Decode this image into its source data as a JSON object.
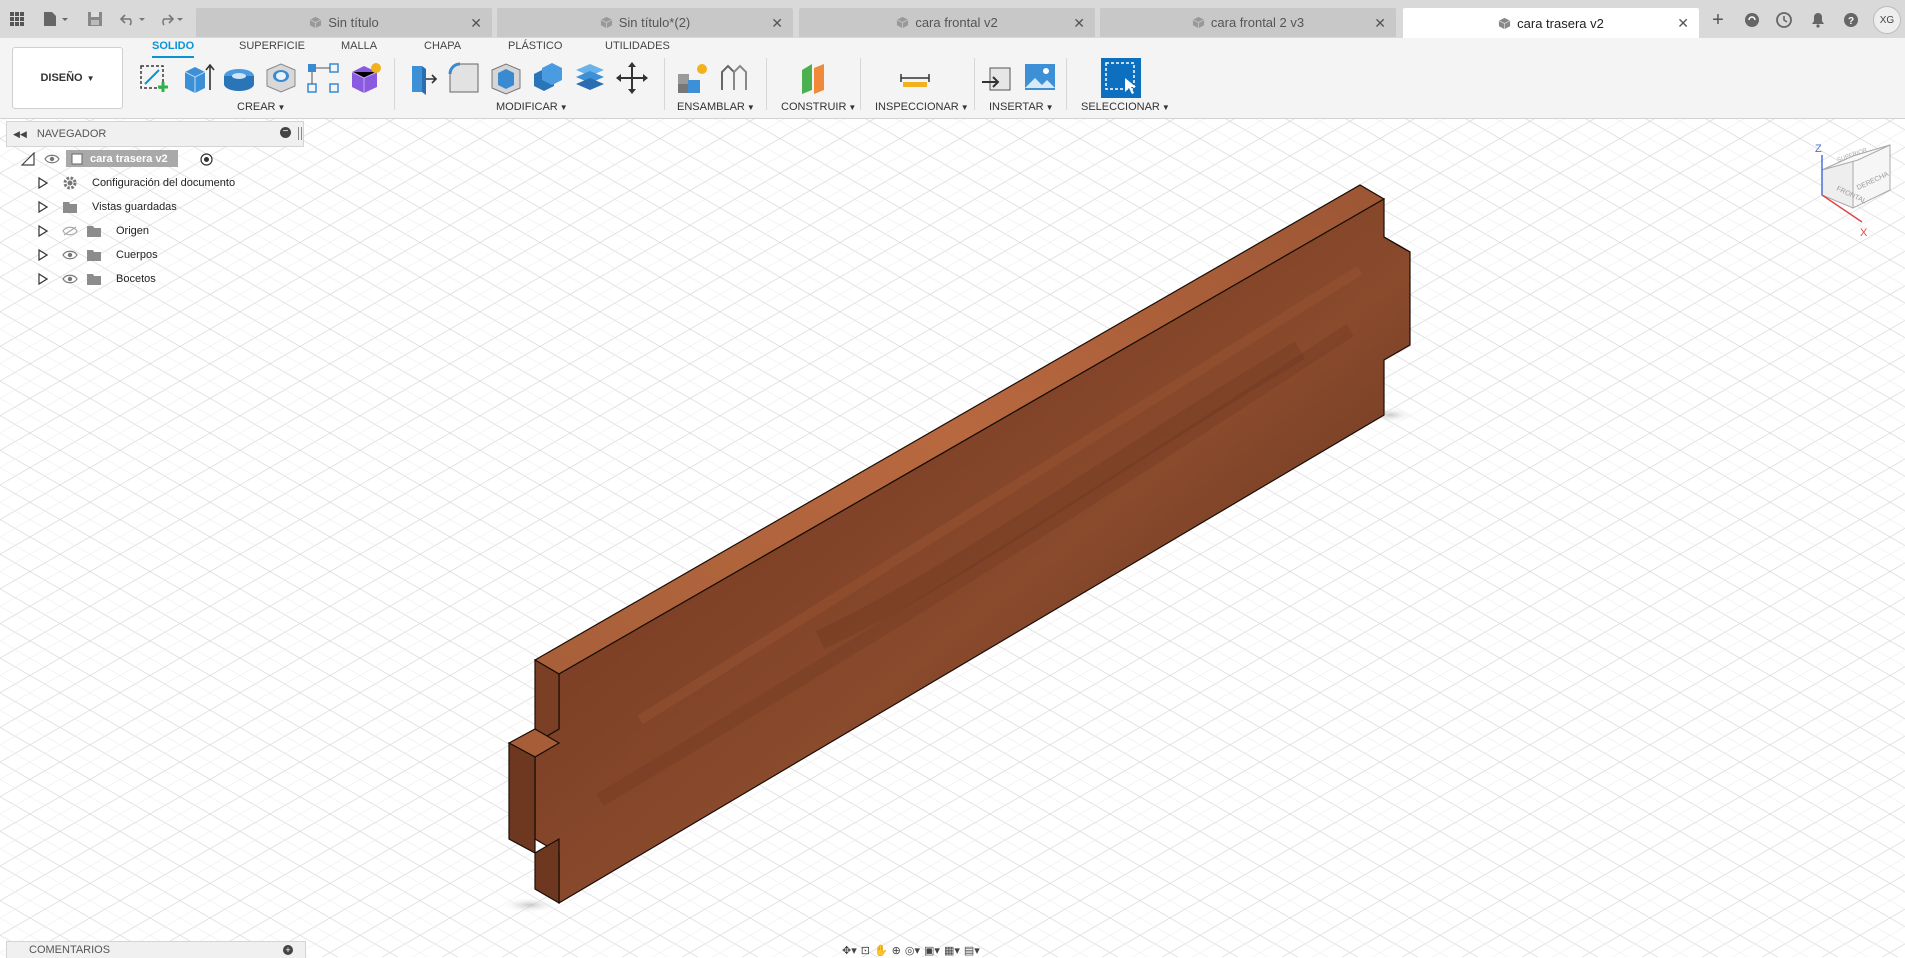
{
  "app": {
    "quick_access": [
      "grid-apps-icon",
      "file-icon",
      "save-icon",
      "undo-icon",
      "redo-icon"
    ],
    "user_initials": "XG"
  },
  "tabs": [
    {
      "label": "Sin título",
      "active": false
    },
    {
      "label": "Sin título*(2)",
      "active": false
    },
    {
      "label": "cara frontal v2",
      "active": false
    },
    {
      "label": "cara frontal 2 v3",
      "active": false
    },
    {
      "label": "cara trasera v2",
      "active": true
    }
  ],
  "ribbon": {
    "workspace": "DISEÑO",
    "tabs": [
      "SOLIDO",
      "SUPERFICIE",
      "MALLA",
      "CHAPA",
      "PLÁSTICO",
      "UTILIDADES"
    ],
    "active_tab": "SOLIDO",
    "groups": {
      "crear": "CREAR",
      "modificar": "MODIFICAR",
      "ensamblar": "ENSAMBLAR",
      "construir": "CONSTRUIR",
      "inspeccionar": "INSPECCIONAR",
      "insertar": "INSERTAR",
      "seleccionar": "SELECCIONAR"
    }
  },
  "navigator": {
    "title": "NAVEGADOR",
    "root": "cara trasera v2",
    "items": [
      {
        "label": "Configuración del documento",
        "icon": "gear-icon"
      },
      {
        "label": "Vistas guardadas",
        "icon": "folder-icon"
      },
      {
        "label": "Origen",
        "icon": "folder-icon",
        "visible": false
      },
      {
        "label": "Cuerpos",
        "icon": "folder-icon",
        "visible": true
      },
      {
        "label": "Bocetos",
        "icon": "folder-icon",
        "visible": true
      }
    ]
  },
  "comments": {
    "title": "COMENTARIOS"
  },
  "viewcube": {
    "faces": [
      "SUPERIOR",
      "FRONTAL",
      "DERECHA"
    ],
    "axes": [
      "Z",
      "X"
    ]
  },
  "colors": {
    "accent": "#0696d7",
    "wood": "#8a4a2c",
    "tab_bar": "#d9d9d9"
  }
}
